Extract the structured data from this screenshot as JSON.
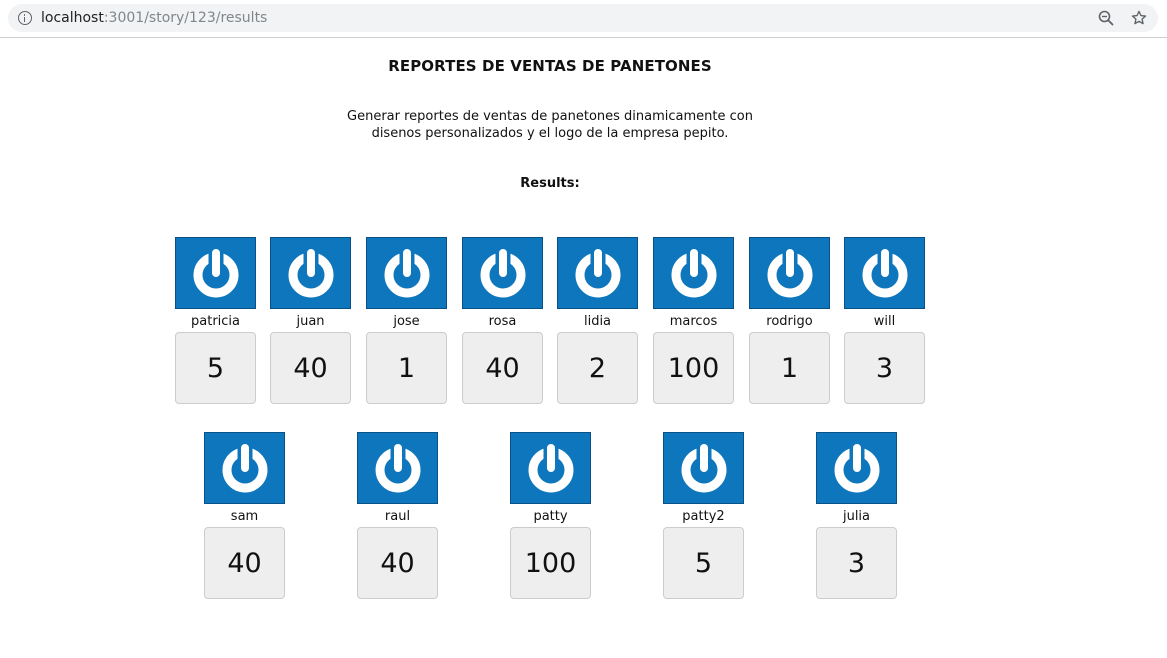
{
  "browser": {
    "url_host": "localhost",
    "url_path": ":3001/story/123/results",
    "icons": [
      "info-icon",
      "zoom-icon",
      "star-icon"
    ]
  },
  "page": {
    "title": "REPORTES DE VENTAS DE PANETONES",
    "description": "Generar reportes de ventas de panetones dinamicamente con disenos personalizados y el logo de la empresa pepito.",
    "results_label": "Results:"
  },
  "results": [
    {
      "name": "patricia",
      "value": "5"
    },
    {
      "name": "juan",
      "value": "40"
    },
    {
      "name": "jose",
      "value": "1"
    },
    {
      "name": "rosa",
      "value": "40"
    },
    {
      "name": "lidia",
      "value": "2"
    },
    {
      "name": "marcos",
      "value": "100"
    },
    {
      "name": "rodrigo",
      "value": "1"
    },
    {
      "name": "will",
      "value": "3"
    },
    {
      "name": "sam",
      "value": "40"
    },
    {
      "name": "raul",
      "value": "40"
    },
    {
      "name": "patty",
      "value": "100"
    },
    {
      "name": "patty2",
      "value": "5"
    },
    {
      "name": "julia",
      "value": "3"
    }
  ],
  "colors": {
    "logo_bg": "#0e76bc",
    "value_bg": "#eeeeee"
  }
}
